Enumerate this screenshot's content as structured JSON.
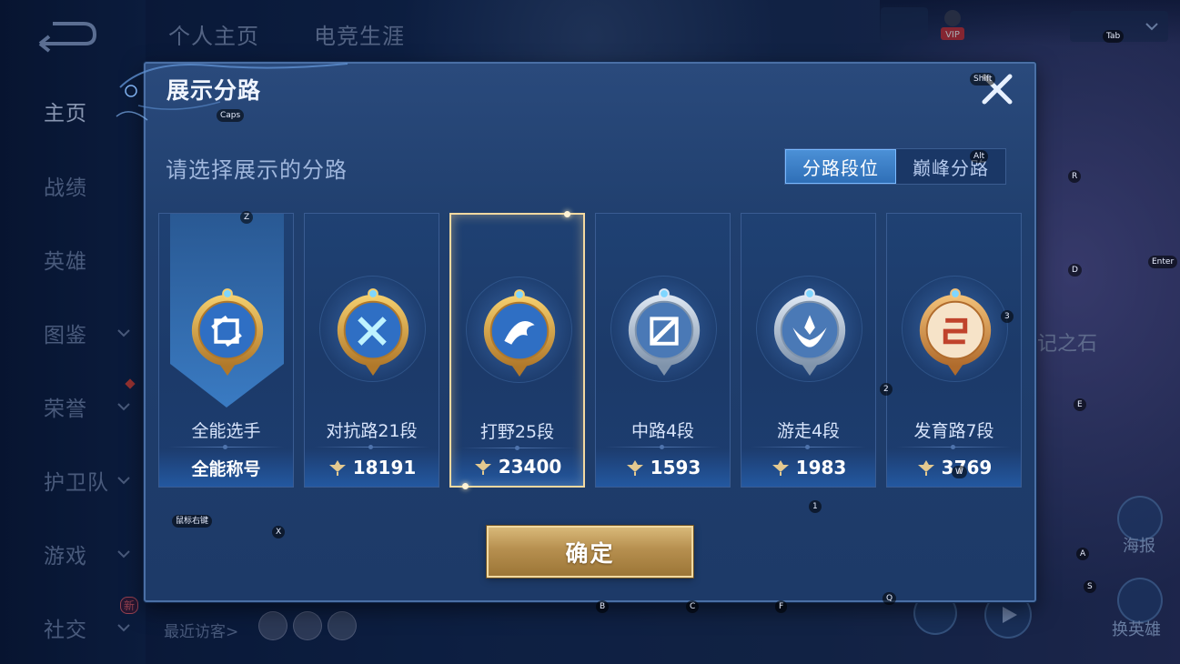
{
  "background": {
    "top_tabs": [
      "个人主页",
      "电竞生涯"
    ],
    "left_nav": [
      {
        "label": "主页",
        "has_chevron": false,
        "active": true
      },
      {
        "label": "战绩",
        "has_chevron": false,
        "active": false
      },
      {
        "label": "英雄",
        "has_chevron": false,
        "active": false
      },
      {
        "label": "图鉴",
        "has_chevron": true,
        "active": false
      },
      {
        "label": "荣誉",
        "has_chevron": true,
        "active": false
      },
      {
        "label": "护卫队",
        "has_chevron": true,
        "active": false
      },
      {
        "label": "游戏",
        "has_chevron": true,
        "active": false
      },
      {
        "label": "社交",
        "has_chevron": true,
        "active": false
      }
    ],
    "new_badge": "新",
    "recent_visitors": "最近访客>",
    "side_buttons": [
      "海报",
      "换英雄"
    ],
    "memory_text": "记之石",
    "vip_label": "VIP"
  },
  "modal": {
    "title": "展示分路",
    "subtitle": "请选择展示的分路",
    "toggle": [
      {
        "label": "分路段位",
        "active": true
      },
      {
        "label": "巅峰分路",
        "active": false
      }
    ],
    "cards": [
      {
        "label": "全能选手",
        "bottom": "全能称号",
        "type": "title",
        "icon": "allround-emblem-icon",
        "selected": false
      },
      {
        "label": "对抗路21段",
        "bottom": "18191",
        "type": "score",
        "icon": "clash-lane-emblem-icon",
        "selected": false
      },
      {
        "label": "打野25段",
        "bottom": "23400",
        "type": "score",
        "icon": "jungle-emblem-icon",
        "selected": true
      },
      {
        "label": "中路4段",
        "bottom": "1593",
        "type": "score",
        "icon": "mid-lane-emblem-icon",
        "selected": false
      },
      {
        "label": "游走4段",
        "bottom": "1983",
        "type": "score",
        "icon": "roam-emblem-icon",
        "selected": false
      },
      {
        "label": "发育路7段",
        "bottom": "3769",
        "type": "score",
        "icon": "farm-lane-emblem-icon",
        "selected": false
      }
    ],
    "confirm": "确定"
  },
  "key_hints": [
    {
      "key": "Tab"
    },
    {
      "key": "Shift"
    },
    {
      "key": "Caps"
    },
    {
      "key": "Alt"
    },
    {
      "key": "Z"
    },
    {
      "key": "R"
    },
    {
      "key": "D"
    },
    {
      "key": "Enter"
    },
    {
      "key": "3"
    },
    {
      "key": "2"
    },
    {
      "key": "E"
    },
    {
      "key": "W"
    },
    {
      "key": "1"
    },
    {
      "key": "X"
    },
    {
      "key": "A"
    },
    {
      "key": "S"
    },
    {
      "key": "B"
    },
    {
      "key": "C"
    },
    {
      "key": "F"
    },
    {
      "key": "Q"
    },
    {
      "key": "鼠标右键"
    }
  ],
  "colors": {
    "accent_blue": "#4b90d6",
    "gold": "#d8b878",
    "selected_border": "#f4d9a0"
  }
}
